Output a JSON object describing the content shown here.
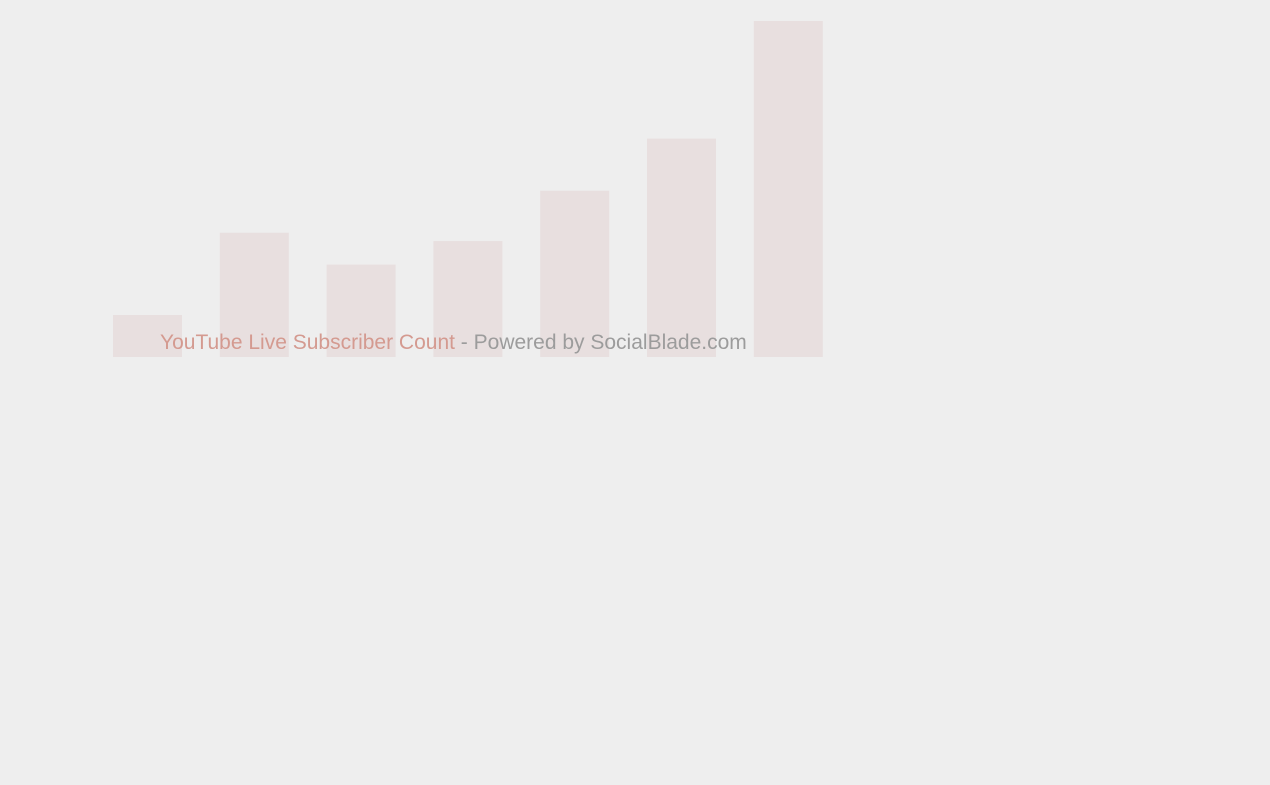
{
  "colors": {
    "background": "#eeeeee",
    "bar": "#e8dfdf",
    "link": "#d49a90",
    "muted": "#9c9c9c"
  },
  "loader": {
    "bar_levels": [
      0.125,
      0.37,
      0.275,
      0.345,
      0.495,
      0.65,
      1.0
    ]
  },
  "caption": {
    "link_text": "YouTube Live Subscriber Count",
    "separator": " - ",
    "powered_text": "Powered by SocialBlade.com"
  }
}
